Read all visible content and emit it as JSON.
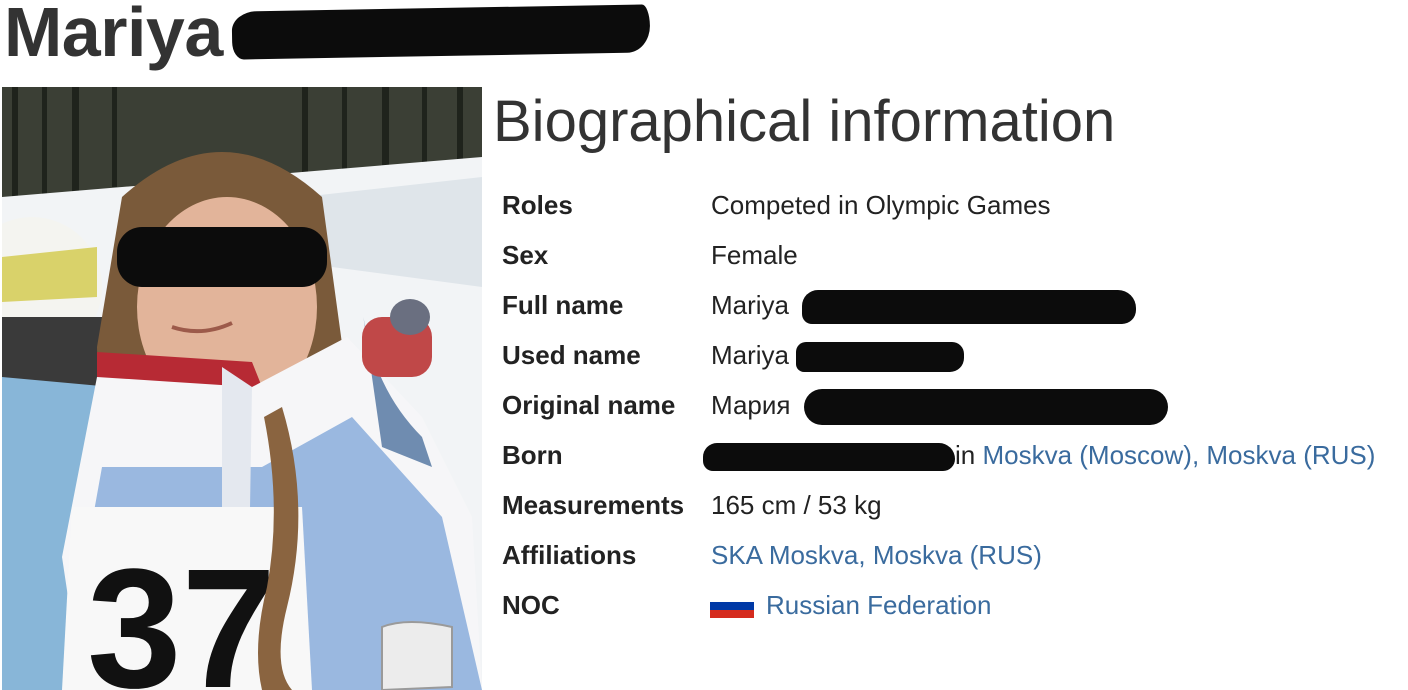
{
  "page_title": "Mariya",
  "section_heading": "Biographical information",
  "bio": {
    "roles": {
      "label": "Roles",
      "value": "Competed in Olympic Games"
    },
    "sex": {
      "label": "Sex",
      "value": "Female"
    },
    "full_name": {
      "label": "Full name",
      "value": "Mariya"
    },
    "used_name": {
      "label": "Used name",
      "value": "Mariya"
    },
    "original_name": {
      "label": "Original name",
      "value": "Мария"
    },
    "born": {
      "label": "Born",
      "prefix": "in ",
      "place_link": "Moskva (Moscow), Moskva (RUS)"
    },
    "measurements": {
      "label": "Measurements",
      "value": "165 cm / 53 kg"
    },
    "affiliations": {
      "label": "Affiliations",
      "value_link": "SKA Moskva, Moskva (RUS)"
    },
    "noc": {
      "label": "NOC",
      "value_link": "Russian Federation",
      "flag_icon": "russia-flag-icon"
    }
  },
  "colors": {
    "link": "#3a6b9e",
    "redaction": "#0c0c0c",
    "flag_white": "#ffffff",
    "flag_blue": "#0039a6",
    "flag_red": "#d52b1e"
  }
}
